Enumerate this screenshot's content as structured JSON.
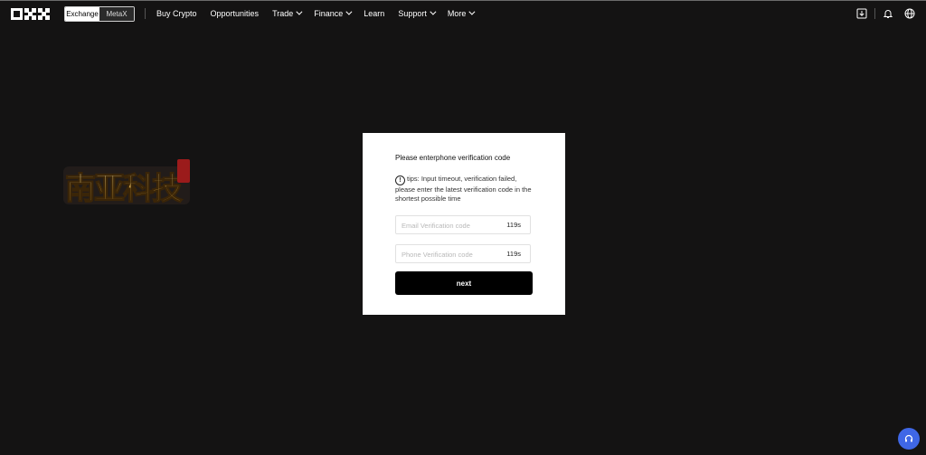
{
  "header": {
    "logo_alt": "OKX",
    "mode_toggle": {
      "exchange_label": "Exchange",
      "metax_label": "MetaX"
    },
    "nav": [
      {
        "label": "Buy Crypto",
        "has_dropdown": false
      },
      {
        "label": "Opportunities",
        "has_dropdown": false
      },
      {
        "label": "Trade",
        "has_dropdown": true
      },
      {
        "label": "Finance",
        "has_dropdown": true
      },
      {
        "label": "Learn",
        "has_dropdown": false
      },
      {
        "label": "Support",
        "has_dropdown": true
      },
      {
        "label": "More",
        "has_dropdown": true
      }
    ],
    "icons": [
      "download-icon",
      "bell-icon",
      "globe-icon"
    ]
  },
  "brand_image": {
    "text": "南亚科技"
  },
  "verification": {
    "title": "Please enterphone verification code",
    "tips_text": "tips: Input timeout, verification failed, please enter the latest verification code in the shortest possible time",
    "email_field": {
      "placeholder": "Email Verification code",
      "value": "",
      "timer": "119s"
    },
    "phone_field": {
      "placeholder": "Phone Verification code",
      "value": "",
      "timer": "119s"
    },
    "next_label": "next"
  },
  "colors": {
    "background": "#141313",
    "card": "#ffffff",
    "button": "#000000",
    "support_fab": "#3f67e6"
  }
}
